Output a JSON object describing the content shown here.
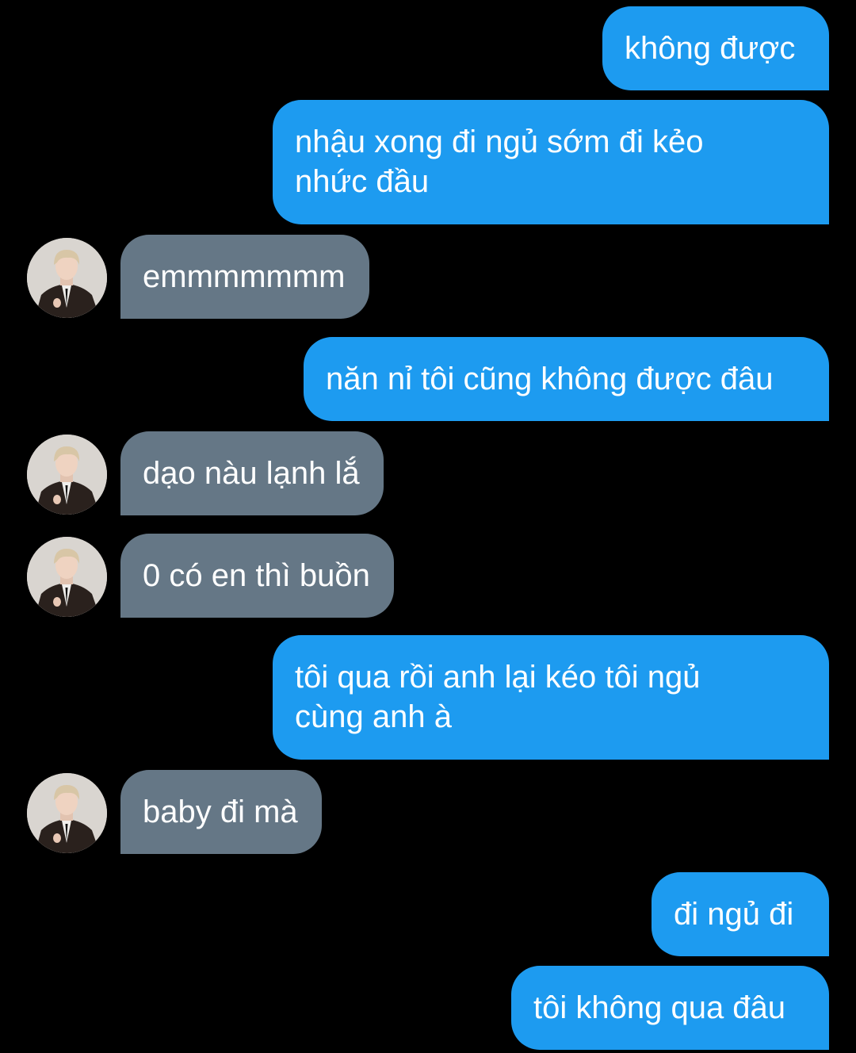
{
  "conversation": {
    "colors": {
      "background": "#000000",
      "sent_bubble": "#1d9bf0",
      "received_bubble": "#657786",
      "text": "#ffffff"
    },
    "messages": [
      {
        "from": "me",
        "text": "không được"
      },
      {
        "from": "me",
        "text": "nhậu xong đi ngủ sớm đi kẻo nhức đầu"
      },
      {
        "from": "them",
        "text": "emmmmmmm"
      },
      {
        "from": "me",
        "text": "năn nỉ tôi cũng không được đâu"
      },
      {
        "from": "them",
        "text": "dạo nàu lạnh lắ"
      },
      {
        "from": "them",
        "text": "0 có en thì buồn"
      },
      {
        "from": "me",
        "text": "tôi qua rồi anh lại kéo tôi ngủ cùng anh à"
      },
      {
        "from": "them",
        "text": "baby đi mà"
      },
      {
        "from": "me",
        "text": "đi ngủ đi"
      },
      {
        "from": "me",
        "text": "tôi không qua đâu"
      }
    ]
  }
}
